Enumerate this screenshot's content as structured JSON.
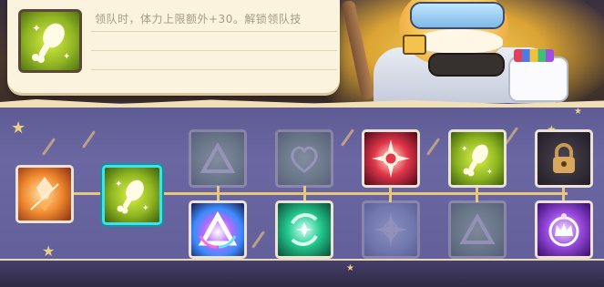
{
  "tooltip": {
    "text": "领队时，体力上限额外+30。解锁领队技",
    "icon": "drumstick-sparkle-icon"
  },
  "skill_tree": {
    "root": {
      "icon": "fire-crystal-icon",
      "state": "unlocked"
    },
    "selected": {
      "icon": "drumstick-sparkle-icon",
      "state": "selected"
    },
    "upper_row": [
      {
        "icon": "triangle-rune-icon",
        "state": "locked-dim"
      },
      {
        "icon": "heart-icon",
        "state": "locked-dim"
      },
      {
        "icon": "compass-burst-icon",
        "state": "unlocked"
      },
      {
        "icon": "drumstick-sparkle-icon",
        "state": "unlocked"
      },
      {
        "icon": "padlock-icon",
        "state": "locked"
      }
    ],
    "lower_row": [
      {
        "icon": "rainbow-triangle-icon",
        "state": "unlocked"
      },
      {
        "icon": "swirl-orb-icon",
        "state": "unlocked"
      },
      {
        "icon": "snowflake-burst-icon",
        "state": "locked-dim"
      },
      {
        "icon": "triangle-rune-icon",
        "state": "locked-dim"
      },
      {
        "icon": "crown-orb-icon",
        "state": "unlocked"
      }
    ]
  },
  "colors": {
    "banner": "#625f9a",
    "connector": "#e7c77a",
    "selected_border": "#3de3e8",
    "tooltip_bg": "#fbf3de"
  }
}
